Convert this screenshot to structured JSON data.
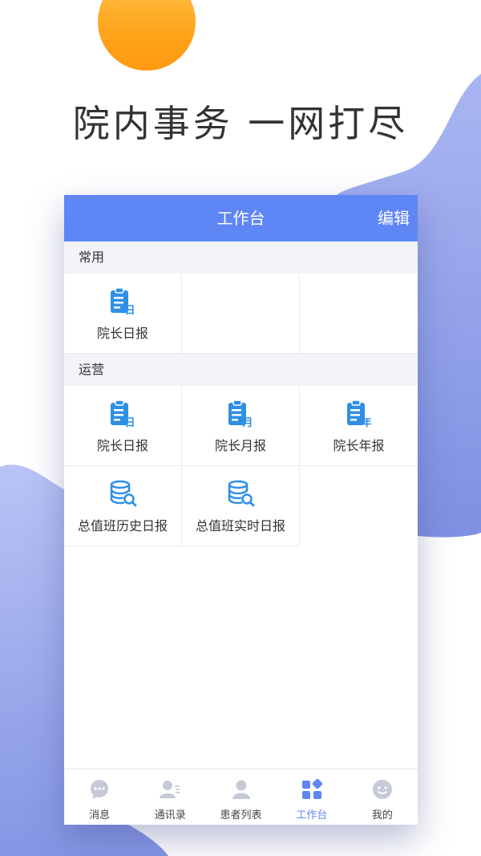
{
  "headline": "院内事务 一网打尽",
  "navbar": {
    "title": "工作台",
    "edit_label": "编辑"
  },
  "sections": [
    {
      "title": "常用",
      "items": [
        {
          "label": "院长日报",
          "icon": "daily-report-icon",
          "badge": "日"
        }
      ]
    },
    {
      "title": "运营",
      "items": [
        {
          "label": "院长日报",
          "icon": "daily-report-icon",
          "badge": "日"
        },
        {
          "label": "院长月报",
          "icon": "monthly-report-icon",
          "badge": "月"
        },
        {
          "label": "院长年报",
          "icon": "yearly-report-icon",
          "badge": "年"
        },
        {
          "label": "总值班历史日报",
          "icon": "database-search-icon"
        },
        {
          "label": "总值班实时日报",
          "icon": "database-search-icon"
        }
      ]
    }
  ],
  "tabbar": {
    "items": [
      {
        "label": "消息",
        "icon": "chat-bubble-icon"
      },
      {
        "label": "通讯录",
        "icon": "contacts-icon"
      },
      {
        "label": "患者列表",
        "icon": "person-icon"
      },
      {
        "label": "工作台",
        "icon": "workbench-grid-icon",
        "active": true
      },
      {
        "label": "我的",
        "icon": "smiley-face-icon"
      }
    ]
  },
  "colors": {
    "accent": "#5f86f5",
    "icon_blue": "#2f8fe6",
    "sun": "#ffa51c",
    "blob": "#8d9de8",
    "tab_inactive": "#c5cad6"
  }
}
